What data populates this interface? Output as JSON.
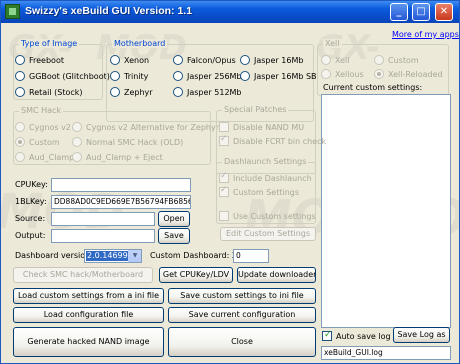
{
  "window": {
    "title": "Swizzy's xeBuild GUI Version: 1.1",
    "minimize": "_",
    "maximize": "□",
    "close": "✕"
  },
  "type_of_image": {
    "title": "Type of Image",
    "options": [
      "Freeboot",
      "GGBoot (Glitchboot)",
      "Retail (Stock)"
    ]
  },
  "motherboard": {
    "title": "Motherboard",
    "options": [
      "Xenon",
      "Falcon/Opus",
      "Jasper 16Mb",
      "Trinity",
      "Jasper 256Mb",
      "Jasper 16Mb SB",
      "Zephyr",
      "Jasper 512Mb"
    ]
  },
  "xell": {
    "title": "Xell",
    "options": [
      "Xell",
      "Custom",
      "Xellous",
      "Xell-Reloaded"
    ],
    "selected": "Xell-Reloaded"
  },
  "more_apps": "More of my apps",
  "current_settings": {
    "label": "Current custom settings:"
  },
  "smc_hack": {
    "title": "SMC Hack",
    "options": [
      "Cygnos v2",
      "Cygnos v2 Alternative for Zephyr",
      "Custom",
      "Normal SMC Hack (OLD)",
      "Aud_Clamp",
      "Aud_Clamp + Eject"
    ],
    "selected": "Custom"
  },
  "special_patches": {
    "title": "Special Patches",
    "options": [
      "Disable NAND MU",
      "Disable FCRT bin check"
    ],
    "checked": [
      "Disable FCRT bin check"
    ]
  },
  "dashlaunch": {
    "title": "Dashlaunch Settings",
    "options": [
      "Include Dashlaunch",
      "Custom Settings"
    ],
    "checked": [
      "Include Dashlaunch",
      "Custom Settings"
    ]
  },
  "use_custom_settings": "Use Custom settings",
  "edit_custom_settings": "Edit Custom Settings",
  "keys": {
    "cpukey_label": "CPUKey:",
    "cpukey_value": "",
    "1blkey_label": "1BLKey:",
    "1blkey_value": "DD88AD0C9ED669E7B56794FB68563EFA",
    "source_label": "Source:",
    "source_value": "",
    "output_label": "Output:",
    "output_value": ""
  },
  "buttons": {
    "open": "Open",
    "save": "Save",
    "check_smc": "Check SMC hack/Motherboard",
    "get_cpukey": "Get CPUKey/LDV",
    "update_downloader": "Update downloader",
    "load_ini": "Load custom settings from a ini file",
    "save_ini": "Save custom settings to ini file",
    "load_config": "Load configuration file",
    "save_config": "Save current configuration",
    "generate": "Generate hacked NAND image",
    "close": "Close",
    "save_log": "Save Log as"
  },
  "dashboard": {
    "label": "Dashboard version:",
    "value": "2.0.14699.0",
    "custom_label": "Custom Dashboard: 2.0.",
    "custom_value": "0"
  },
  "auto_save_log": {
    "label": "Auto save log file",
    "checked": true
  },
  "log_file": "xeBuild_GUI.log",
  "watermark": [
    "GX-",
    "MOD",
    "MOD.COM"
  ]
}
